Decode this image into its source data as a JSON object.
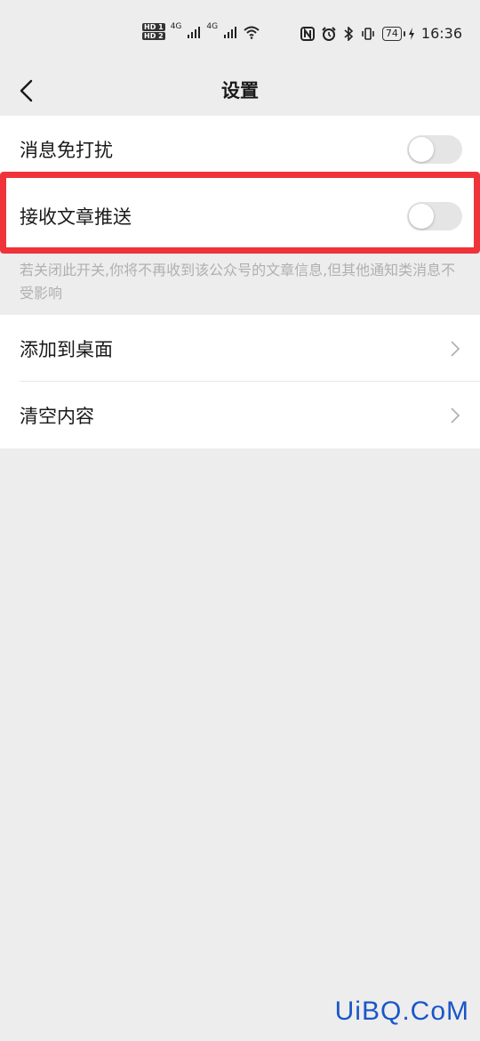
{
  "status_bar": {
    "hd_badge_1": "HD 1",
    "hd_badge_2": "HD 2",
    "signal_label_1": "4G",
    "signal_label_2": "4G",
    "battery": "74",
    "time": "16:36",
    "icons": [
      "nfc-icon",
      "alarm-icon",
      "bluetooth-icon",
      "vibrate-icon",
      "battery-icon",
      "charging-icon",
      "wifi-icon",
      "signal-icon"
    ]
  },
  "nav": {
    "title": "设置"
  },
  "settings": {
    "dnd_label": "消息免打扰",
    "dnd_on": false,
    "push_label": "接收文章推送",
    "push_on": false,
    "hint": "若关闭此开关,你将不再收到该公众号的文章信息,但其他通知类消息不受影响",
    "add_desktop_label": "添加到桌面",
    "clear_label": "清空内容"
  },
  "colors": {
    "highlight": "#f0333a",
    "background": "#ededed",
    "watermark": "#1a56c9"
  },
  "watermark": "UiBQ.CoM"
}
